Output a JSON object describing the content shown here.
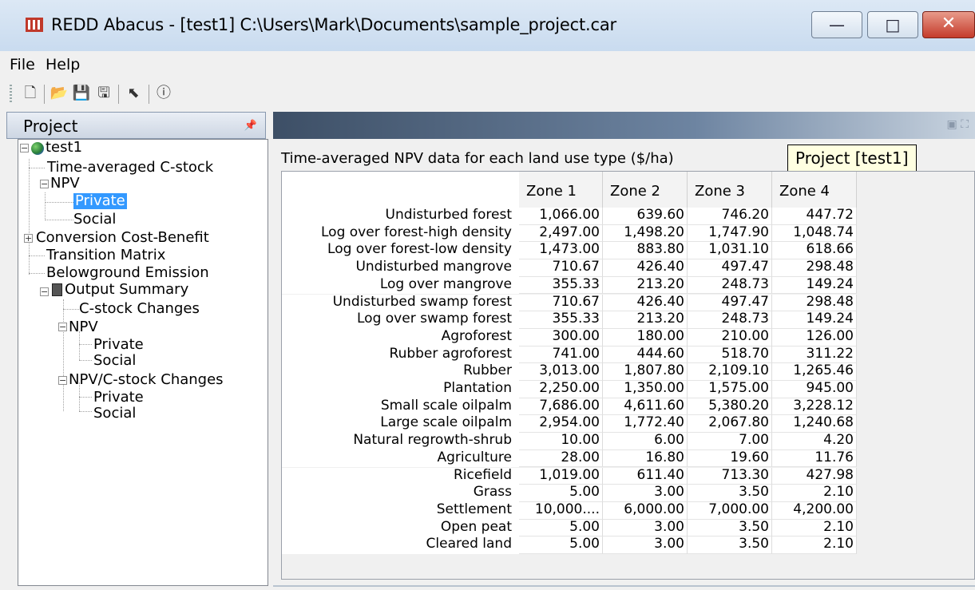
{
  "window": {
    "title": "REDD Abacus - [test1] C:\\Users\\Mark\\Documents\\sample_project.car",
    "min_glyph": "—",
    "max_glyph": "□",
    "close_glyph": "✕"
  },
  "menu": {
    "file": "File",
    "help": "Help"
  },
  "toolbar": {
    "icons": [
      "new-project-icon",
      "open-icon",
      "save-icon",
      "save-as-icon",
      "pointer-help-icon",
      "about-icon"
    ],
    "glyphs": {
      "new": "🗋",
      "open": "📂",
      "save": "💾",
      "save_as": "🖫",
      "pointer": "⬉",
      "about": "ⓘ"
    }
  },
  "project_pane": {
    "title": "Project",
    "tree": {
      "root": "test1",
      "time_averaged": "Time-averaged C-stock",
      "npv": "NPV",
      "npv_private": "Private",
      "npv_social": "Social",
      "conversion": "Conversion Cost-Benefit",
      "transition": "Transition Matrix",
      "belowground": "Belowground Emission",
      "output_summary": "Output Summary",
      "cstock_changes": "C-stock Changes",
      "out_npv": "NPV",
      "out_npv_private": "Private",
      "out_npv_social": "Social",
      "npv_cstock": "NPV/C-stock Changes",
      "npv_cstock_private": "Private",
      "npv_cstock_social": "Social"
    }
  },
  "doc": {
    "caption": "Time-averaged NPV data for each land use type ($/ha)",
    "tooltip": "Project  [test1]"
  },
  "table": {
    "columns": [
      "Zone 1",
      "Zone 2",
      "Zone 3",
      "Zone 4"
    ],
    "rows": [
      {
        "label": "Undisturbed forest",
        "values": [
          "1,066.00",
          "639.60",
          "746.20",
          "447.72"
        ]
      },
      {
        "label": "Log over forest-high density",
        "values": [
          "2,497.00",
          "1,498.20",
          "1,747.90",
          "1,048.74"
        ]
      },
      {
        "label": "Log over forest-low density",
        "values": [
          "1,473.00",
          "883.80",
          "1,031.10",
          "618.66"
        ]
      },
      {
        "label": "Undisturbed mangrove",
        "values": [
          "710.67",
          "426.40",
          "497.47",
          "298.48"
        ]
      },
      {
        "label": "Log over mangrove",
        "values": [
          "355.33",
          "213.20",
          "248.73",
          "149.24"
        ]
      },
      {
        "label": "Undisturbed swamp forest",
        "values": [
          "710.67",
          "426.40",
          "497.47",
          "298.48"
        ]
      },
      {
        "label": "Log over swamp forest",
        "values": [
          "355.33",
          "213.20",
          "248.73",
          "149.24"
        ]
      },
      {
        "label": "Agroforest",
        "values": [
          "300.00",
          "180.00",
          "210.00",
          "126.00"
        ]
      },
      {
        "label": "Rubber agroforest",
        "values": [
          "741.00",
          "444.60",
          "518.70",
          "311.22"
        ]
      },
      {
        "label": "Rubber",
        "values": [
          "3,013.00",
          "1,807.80",
          "2,109.10",
          "1,265.46"
        ]
      },
      {
        "label": "Plantation",
        "values": [
          "2,250.00",
          "1,350.00",
          "1,575.00",
          "945.00"
        ]
      },
      {
        "label": "Small scale oilpalm",
        "values": [
          "7,686.00",
          "4,611.60",
          "5,380.20",
          "3,228.12"
        ]
      },
      {
        "label": "Large scale oilpalm",
        "values": [
          "2,954.00",
          "1,772.40",
          "2,067.80",
          "1,240.68"
        ]
      },
      {
        "label": "Natural regrowth-shrub",
        "values": [
          "10.00",
          "6.00",
          "7.00",
          "4.20"
        ]
      },
      {
        "label": "Agriculture",
        "values": [
          "28.00",
          "16.80",
          "19.60",
          "11.76"
        ]
      },
      {
        "label": "Ricefield",
        "values": [
          "1,019.00",
          "611.40",
          "713.30",
          "427.98"
        ]
      },
      {
        "label": "Grass",
        "values": [
          "5.00",
          "3.00",
          "3.50",
          "2.10"
        ]
      },
      {
        "label": "Settlement",
        "values": [
          "10,000....",
          "6,000.00",
          "7,000.00",
          "4,200.00"
        ]
      },
      {
        "label": "Open peat",
        "values": [
          "5.00",
          "3.00",
          "3.50",
          "2.10"
        ]
      },
      {
        "label": "Cleared land",
        "values": [
          "5.00",
          "3.00",
          "3.50",
          "2.10"
        ]
      }
    ]
  }
}
